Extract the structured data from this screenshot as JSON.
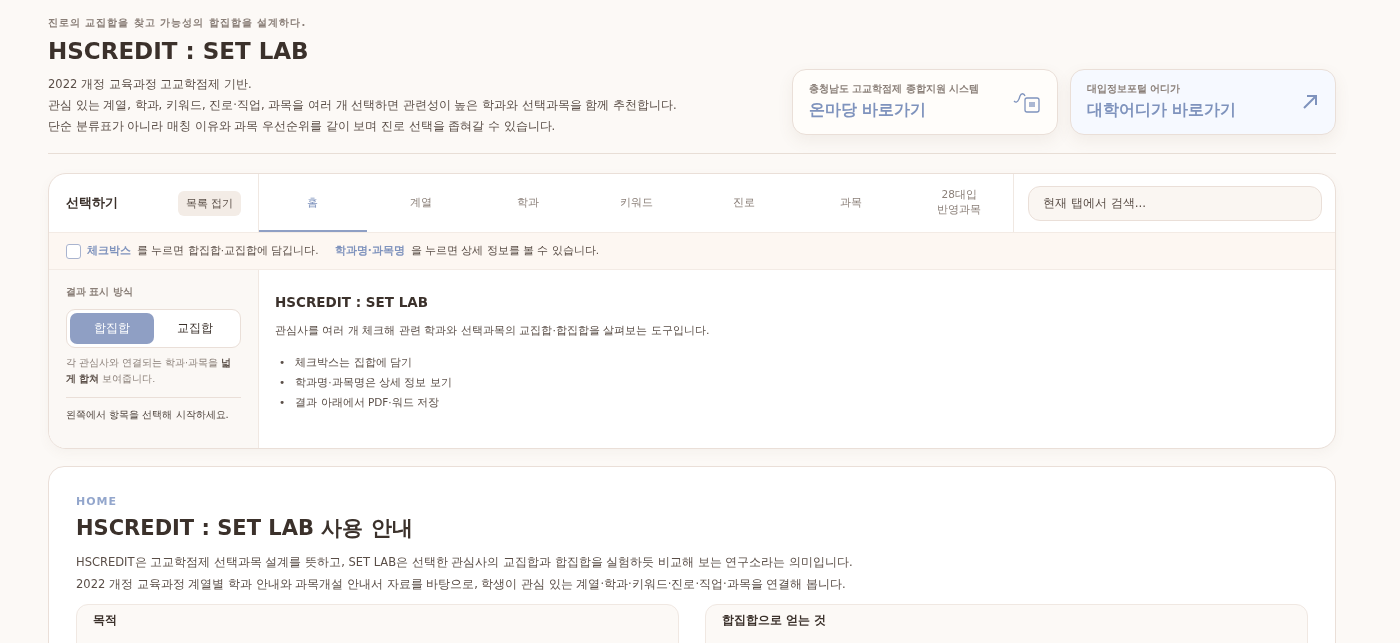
{
  "header": {
    "tagline": "진로의 교집합을 찾고 가능성의 합집합을 설계하다.",
    "title": "HSCREDIT : SET LAB",
    "intro": [
      "2022 개정 교육과정 고교학점제 기반.",
      "관심 있는 계열, 학과, 키워드, 진로·직업, 과목을 여러 개 선택하면 관련성이 높은 학과와 선택과목을 함께 추천합니다.",
      "단순 분류표가 아니라 매칭 이유와 과목 우선순위를 같이 보며 진로 선택을 좁혀갈 수 있습니다."
    ]
  },
  "links": [
    {
      "caption": "충청남도 고교학점제 종합지원 시스템",
      "label": "온마당 바로가기",
      "kind": "bag"
    },
    {
      "caption": "대입정보포털 어디가",
      "label": "대학어디가 바로가기",
      "kind": "arrow"
    }
  ],
  "panel": {
    "sidebar_title": "선택하기",
    "collapse_button": "목록 접기",
    "tabs": [
      {
        "label": "홈",
        "selected": true
      },
      {
        "label": "계열",
        "selected": false
      },
      {
        "label": "학과",
        "selected": false
      },
      {
        "label": "키워드",
        "selected": false
      },
      {
        "label": "진로",
        "selected": false
      },
      {
        "label": "과목",
        "selected": false
      },
      {
        "label": "28대입\n반영과목",
        "selected": false
      }
    ],
    "search": {
      "placeholder": "현재 탭에서 검색..."
    },
    "notice": {
      "checked": false,
      "checkbox_term": "체크박스",
      "checkbox_text": "를 누르면 합집합·교집합에 담깁니다.",
      "name_term": "학과명·과목명",
      "name_text": "을 누르면 상세 정보를 볼 수 있습니다."
    },
    "sidebar": {
      "mode_label": "결과 표시 방식",
      "modes": [
        {
          "label": "합집합",
          "selected": true
        },
        {
          "label": "교집합",
          "selected": false
        }
      ],
      "mode_hint": "각 관심사와 연결되는 학과·과목을 **넓게 합쳐** 보여줍니다.",
      "empty_text": "왼쪽에서 항목을 선택해 시작하세요."
    },
    "content": {
      "title": "HSCREDIT : SET LAB",
      "description": "관심사를 여러 개 체크해 관련 학과와 선택과목의 교집합·합집합을 살펴보는 도구입니다.",
      "bullets": [
        {
          "marker": "•",
          "text": "체크박스는 집합에 담기"
        },
        {
          "marker": "•",
          "text": "학과명·과목명은 상세 정보 보기"
        },
        {
          "marker": "•",
          "text": "결과 아래에서 PDF·워드 저장"
        }
      ]
    }
  },
  "guide": {
    "eyebrow": "HOME",
    "title": "HSCREDIT : SET LAB 사용 안내",
    "paragraphs": [
      "HSCREDIT은 고교학점제 선택과목 설계를 뜻하고, SET LAB은 선택한 관심사의 교집합과 합집합을 실험하듯 비교해 보는 연구소라는 의미입니다.",
      "2022 개정 교육과정 계열별 학과 안내와 과목개설 안내서 자료를 바탕으로, 학생이 관심 있는 계열·학과·키워드·진로·직업·과목을 연결해 봅니다."
    ],
    "cards": [
      {
        "title": "목적"
      },
      {
        "title": "합집합으로 얻는 것"
      }
    ]
  }
}
